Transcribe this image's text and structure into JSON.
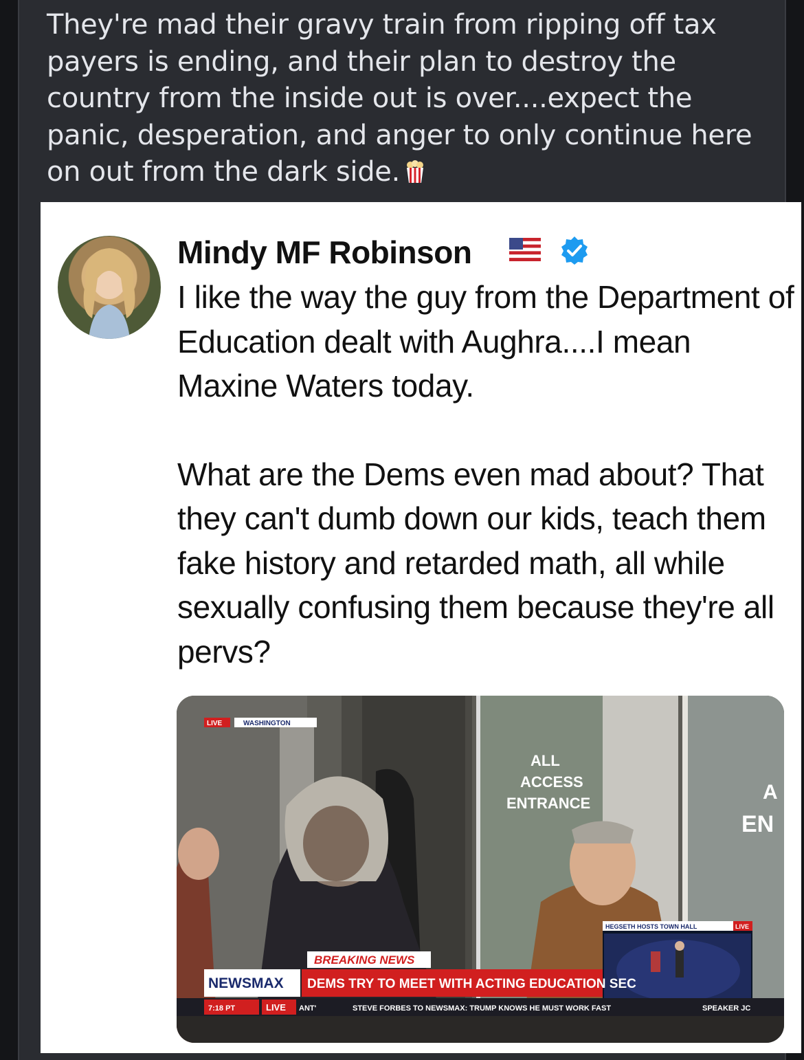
{
  "post": {
    "text": "They're mad their gravy train from ripping off tax payers is ending, and their plan to destroy the country from the inside out is over....expect the panic, desperation, and anger to only continue here on out from the dark side."
  },
  "tweet": {
    "author": "Mindy MF Robinson",
    "paragraph1": "I like the way the guy from the Department of Education dealt with Aughra....I mean Maxine Waters today.",
    "paragraph2": "What are the Dems even mad about? That they can't dumb down our kids, teach them fake history and retarded math, all while sexually confusing them because they're all pervs?"
  },
  "broadcast": {
    "live_tag": "LIVE",
    "location": "WASHINGTON",
    "sign_text": [
      "ALL",
      "ACCESS",
      "ENTRANCE"
    ],
    "sign_fragment": "EN",
    "sign_fragment_top": "A",
    "breaking": "BREAKING NEWS",
    "network": "NEWSMAX",
    "headline": "DEMS TRY TO MEET WITH ACTING EDUCATION SEC",
    "inset_label": "HEGSETH HOSTS TOWN HALL",
    "inset_live": "LIVE",
    "time": "7:18 PT",
    "ticker_live": "LIVE",
    "ticker_fragment": "ANT'",
    "ticker_text": "STEVE FORBES TO NEWSMAX: TRUMP KNOWS HE MUST WORK FAST",
    "ticker_tail": "SPEAKER JC"
  },
  "colors": {
    "page_bg": "#141518",
    "card_bg": "#2a2c31",
    "verified_blue": "#1d9bf0",
    "newsmax_red": "#d11f1f",
    "breaking_white": "#ffffff"
  },
  "icons": [
    "popcorn-icon",
    "us-flag-icon",
    "verified-badge-icon"
  ]
}
